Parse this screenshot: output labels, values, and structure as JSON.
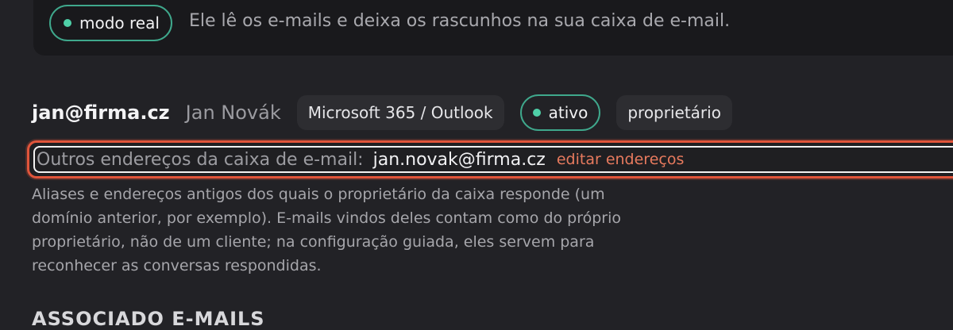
{
  "mode": {
    "badge_label": "modo real",
    "description": "Ele lê os e-mails e deixa os rascunhos na sua caixa de e-mail.",
    "dot_color": "#4fd0a8"
  },
  "account": {
    "email": "jan@firma.cz",
    "name": "Jan Novák",
    "provider": "Microsoft 365 / Outlook",
    "status": "ativo",
    "role": "proprietário"
  },
  "aliases": {
    "label": "Outros endereços da caixa de e-mail:",
    "value": "jan.novak@firma.cz",
    "edit_label": "editar endereços",
    "help_text": "Aliases e endereços antigos dos quais o proprietário da caixa responde (um domínio anterior, por exemplo). E-mails vindos deles contam como do próprio proprietário, não de um cliente; na configuração guiada, eles servem para reconhecer as conversas respondidas."
  },
  "next_section": {
    "heading": "ASSOCIADO E-MAILS"
  },
  "colors": {
    "accent_green": "#3fa88c",
    "highlight_red": "#e0553b",
    "link_orange": "#e77a5e",
    "background": "#222226"
  }
}
